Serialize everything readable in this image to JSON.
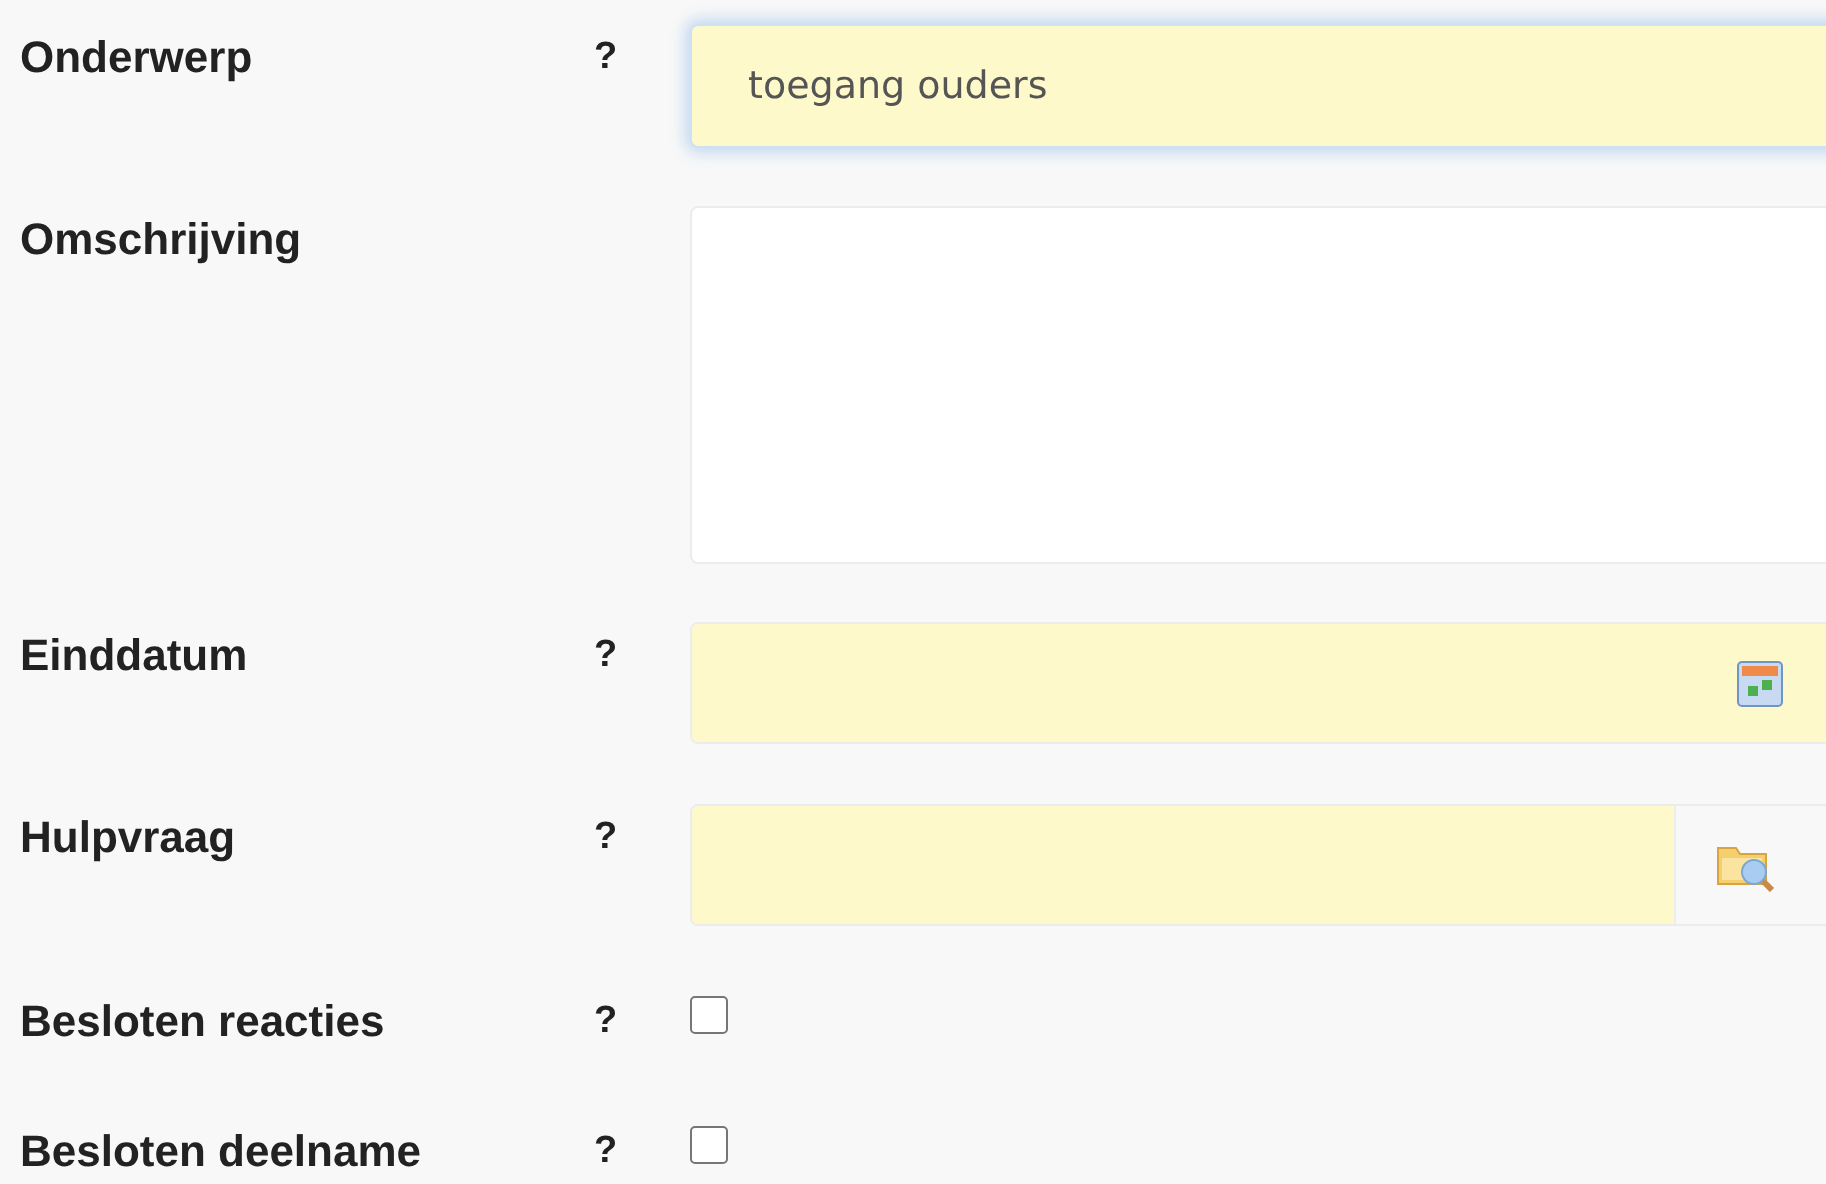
{
  "fields": [
    {
      "kind": "text",
      "label": "Onderwerp",
      "help": "?",
      "value": "toegang ouders",
      "focused": true
    },
    {
      "kind": "textarea",
      "label": "Omschrijving",
      "focused": false
    },
    {
      "kind": "date",
      "label": "Einddatum",
      "help": "?",
      "focused": false
    },
    {
      "kind": "lookup",
      "label": "Hulpvraag",
      "help": "?",
      "focused": false
    },
    {
      "kind": "checkbox",
      "label": "Besloten reacties",
      "help": "?",
      "checked": false
    },
    {
      "kind": "checkbox",
      "label": "Besloten deelname",
      "help": "?",
      "checked": false
    }
  ]
}
